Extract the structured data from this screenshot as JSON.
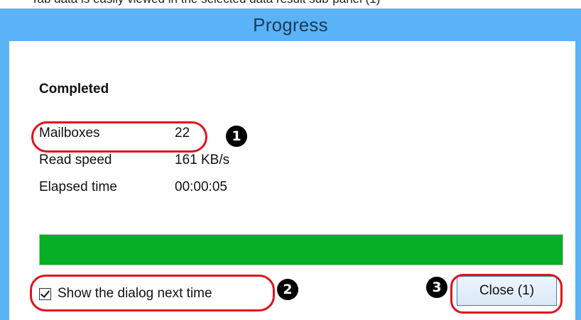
{
  "caption": {
    "text": "Tab data is easily viewed in the selected data result sub-panel (1)"
  },
  "window": {
    "title": "Progress"
  },
  "status": {
    "heading": "Completed"
  },
  "stats": [
    {
      "label": "Mailboxes",
      "value": "22"
    },
    {
      "label": "Read speed",
      "value": "161 KB/s"
    },
    {
      "label": "Elapsed time",
      "value": "00:00:05"
    }
  ],
  "progress": {
    "fraction": 1.0,
    "color": "#06b025"
  },
  "options": {
    "show_dialog_label": "Show the dialog next time",
    "show_dialog_checked": true
  },
  "buttons": {
    "close_label": "Close (1)"
  },
  "annotations": {
    "badges": [
      "1",
      "2",
      "3"
    ],
    "color": "#e0121d"
  }
}
